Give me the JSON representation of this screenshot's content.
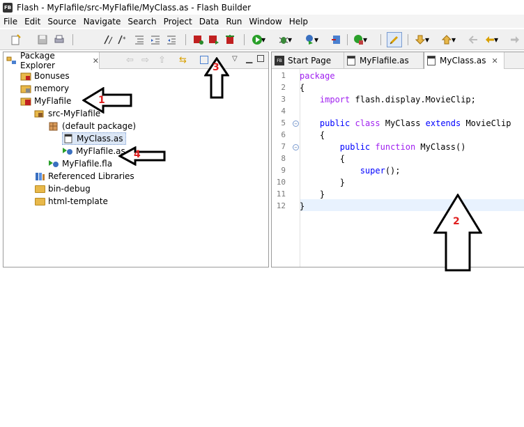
{
  "window": {
    "title": "Flash - MyFlafile/src-MyFlafile/MyClass.as - Flash Builder",
    "icon_text": "FB"
  },
  "menu": [
    "File",
    "Edit",
    "Source",
    "Navigate",
    "Search",
    "Project",
    "Data",
    "Run",
    "Window",
    "Help"
  ],
  "package_explorer": {
    "tab_label": "Package Explorer",
    "items": [
      {
        "label": "Bonuses",
        "icon": "project-folder-icon"
      },
      {
        "label": "memory",
        "icon": "project-folder-icon"
      },
      {
        "label": "MyFlafile",
        "icon": "flash-project-icon"
      },
      {
        "label": "src-MyFlafile",
        "icon": "source-folder-icon"
      },
      {
        "label": "(default package)",
        "icon": "package-icon"
      },
      {
        "label": "MyClass.as",
        "icon": "as-file-icon"
      },
      {
        "label": "MyFlafile.as",
        "icon": "run-as-file-icon"
      },
      {
        "label": "MyFlafile.fla",
        "icon": "fla-file-icon"
      },
      {
        "label": "Referenced Libraries",
        "icon": "library-icon"
      },
      {
        "label": "bin-debug",
        "icon": "folder-icon"
      },
      {
        "label": "html-template",
        "icon": "folder-icon"
      }
    ]
  },
  "editor": {
    "tabs": [
      {
        "label": "Start Page",
        "icon": "fb-icon"
      },
      {
        "label": "MyFlafile.as",
        "icon": "as-file-icon"
      },
      {
        "label": "MyClass.as",
        "icon": "as-file-icon",
        "active": true
      }
    ],
    "lines": [
      {
        "n": "1",
        "text": "package"
      },
      {
        "n": "2",
        "text": "{"
      },
      {
        "n": "3",
        "text": "    import flash.display.MovieClip;"
      },
      {
        "n": "4",
        "text": ""
      },
      {
        "n": "5",
        "text": "    public class MyClass extends MovieClip"
      },
      {
        "n": "6",
        "text": "    {"
      },
      {
        "n": "7",
        "text": "        public function MyClass()"
      },
      {
        "n": "8",
        "text": "        {"
      },
      {
        "n": "9",
        "text": "            super();"
      },
      {
        "n": "10",
        "text": "        }"
      },
      {
        "n": "11",
        "text": "    }"
      },
      {
        "n": "12",
        "text": "}"
      }
    ]
  },
  "annotations": {
    "a1": "1",
    "a2": "2",
    "a3": "3",
    "a4": "4"
  },
  "colors": {
    "keyword": "#a020f0",
    "keyword2": "#0000ff",
    "annotation": "#e02020"
  }
}
